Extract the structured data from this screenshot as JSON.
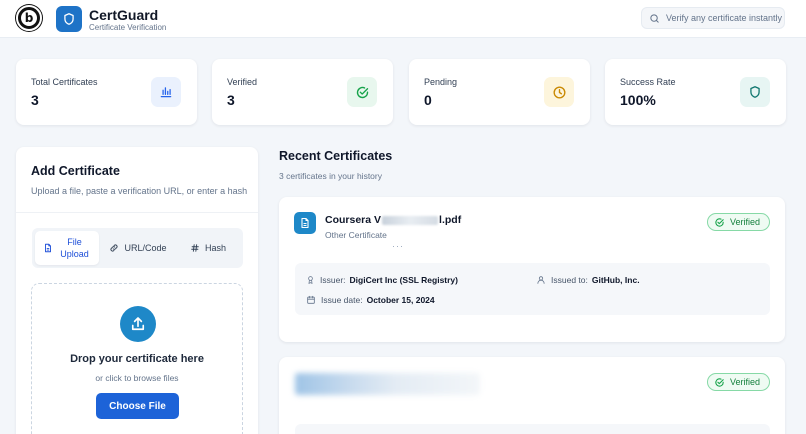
{
  "header": {
    "app_name": "CertGuard",
    "app_subtitle": "Certificate Verification",
    "search_placeholder": "Verify any certificate instantly"
  },
  "stats": [
    {
      "label": "Total Certificates",
      "value": "3",
      "icon": "bar-chart-icon",
      "color": "#2563eb"
    },
    {
      "label": "Verified",
      "value": "3",
      "icon": "check-circle-icon",
      "color": "#16a34a"
    },
    {
      "label": "Pending",
      "value": "0",
      "icon": "clock-icon",
      "color": "#ca8a04"
    },
    {
      "label": "Success Rate",
      "value": "100%",
      "icon": "shield-icon",
      "color": "#0f766e"
    }
  ],
  "add_certificate": {
    "title": "Add Certificate",
    "subtitle": "Upload a file, paste a verification URL, or enter a hash",
    "tabs": [
      "File Upload",
      "URL/Code",
      "Hash"
    ],
    "active_tab": "File Upload",
    "drop_title": "Drop your certificate here",
    "drop_subtitle": "or click to browse files",
    "choose_button": "Choose File"
  },
  "recent": {
    "title": "Recent Certificates",
    "subtitle": "3 certificates in your history",
    "items": [
      {
        "name_prefix": "Coursera V",
        "name_suffix": "l.pdf",
        "type": "Other Certificate",
        "status": "Verified",
        "issuer_label": "Issuer:",
        "issuer": "DigiCert Inc (SSL Registry)",
        "issued_to_label": "Issued to:",
        "issued_to": "GitHub, Inc.",
        "date_label": "Issue date:",
        "date": "October 15, 2024"
      },
      {
        "status": "Verified"
      }
    ]
  },
  "colors": {
    "accent": "#1d63d8",
    "brand": "#1e73c7",
    "verified": "#15803d"
  }
}
